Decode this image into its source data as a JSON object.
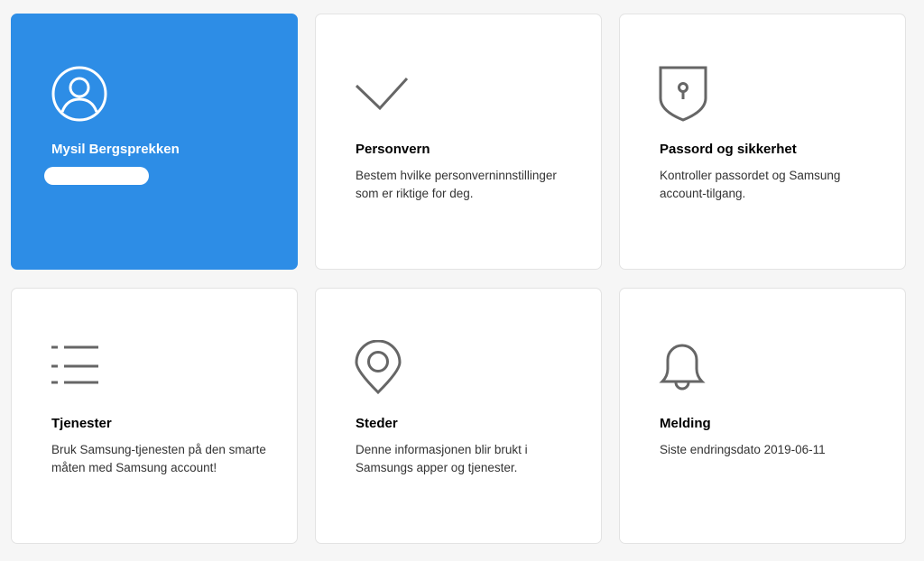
{
  "colors": {
    "profile_card_bg": "#2d8de6",
    "card_bg": "#ffffff",
    "page_bg": "#f6f6f6",
    "icon_stroke": "#666666"
  },
  "profile": {
    "name": "Mysil Bergsprekken",
    "icon": "user-avatar-icon"
  },
  "cards": [
    {
      "icon": "checkmark-icon",
      "title": "Personvern",
      "description": "Bestem hvilke personverninnstillinger som er riktige for deg."
    },
    {
      "icon": "shield-lock-icon",
      "title": "Passord og sikkerhet",
      "description": "Kontroller passordet og Samsung account-tilgang."
    },
    {
      "icon": "list-icon",
      "title": "Tjenester",
      "description": "Bruk Samsung-tjenesten på den smarte måten med Samsung account!"
    },
    {
      "icon": "location-pin-icon",
      "title": "Steder",
      "description": "Denne informasjonen blir brukt i Samsungs apper og tjenester."
    },
    {
      "icon": "bell-icon",
      "title": "Melding",
      "description": "Siste endringsdato 2019-06-11"
    }
  ]
}
